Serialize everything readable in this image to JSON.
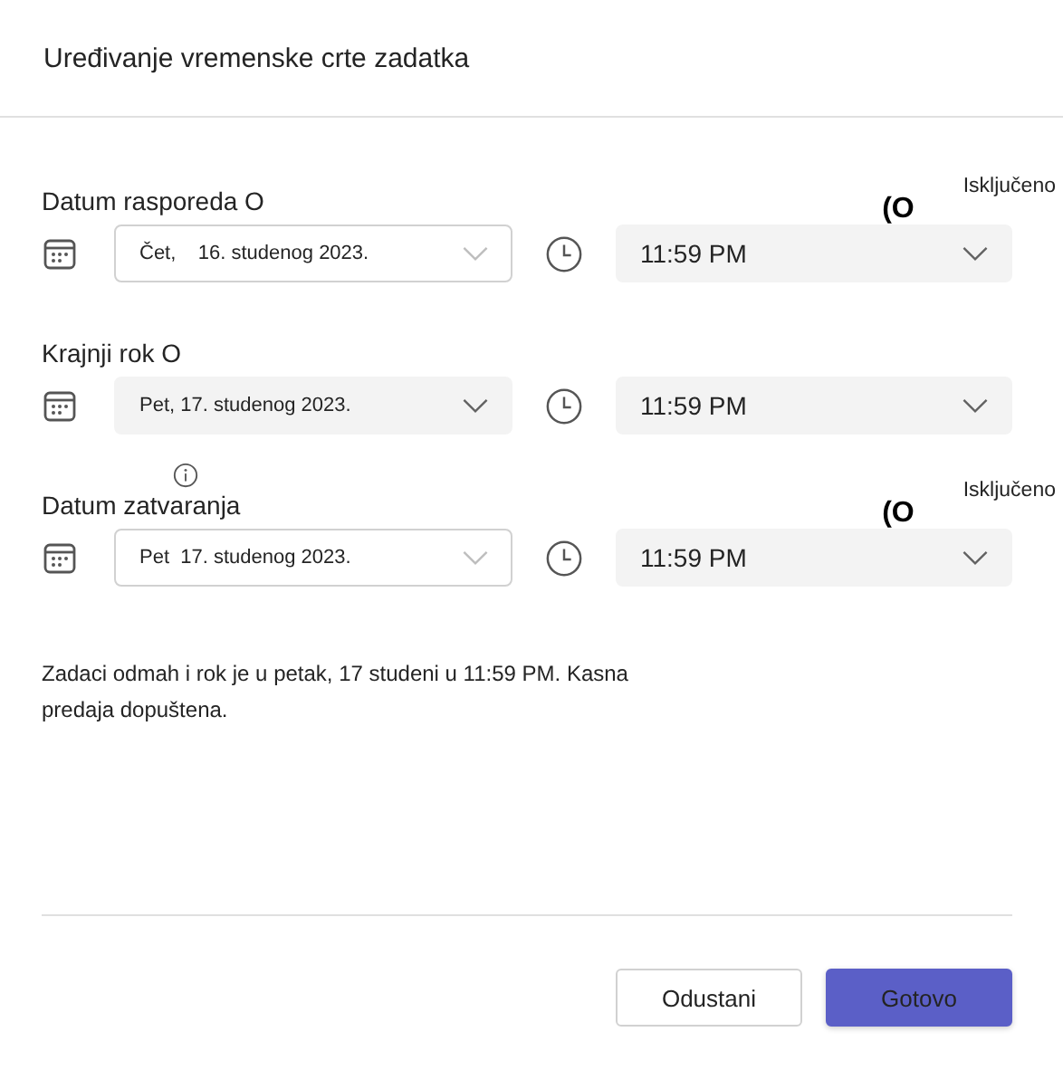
{
  "dialog": {
    "title": "Uređivanje vremenske crte zadatka"
  },
  "sections": [
    {
      "label": "Datum rasporeda O",
      "info_icon": false,
      "toggle": "(O",
      "toggle_label": "Isključeno",
      "date": {
        "kind": "outlined",
        "value": "Čet,    16. studenog 2023."
      },
      "time": "11:59 PM"
    },
    {
      "label": "Krajnji rok O",
      "info_icon": false,
      "date": {
        "kind": "filled",
        "value": "Pet, 17. studenog 2023."
      },
      "time": "11:59 PM"
    },
    {
      "label": "Datum zatvaranja",
      "info_icon": true,
      "toggle": "(O",
      "toggle_label": "Isključeno",
      "date": {
        "kind": "outlined",
        "value": "Pet  17. studenog 2023."
      },
      "time": "11:59 PM"
    }
  ],
  "summary": "Zadaci odmah i rok je u petak, 17 studeni u 11:59 PM. Kasna predaja dopuštena.",
  "buttons": [
    {
      "label": "Odustani",
      "kind": "secondary"
    },
    {
      "label": "Gotovo",
      "kind": "primary"
    }
  ]
}
